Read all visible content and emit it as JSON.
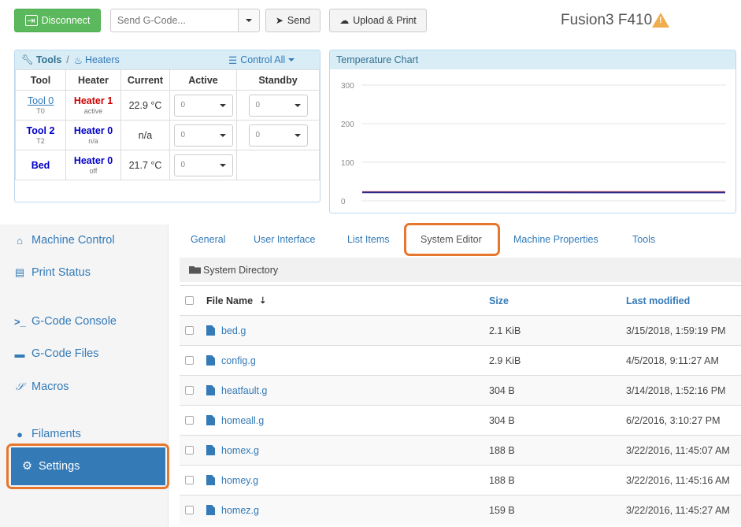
{
  "topbar": {
    "disconnect_label": "Disconnect",
    "gcode_placeholder": "Send G-Code...",
    "send_label": "Send",
    "upload_label": "Upload & Print",
    "machine_name": "Fusion3 F410",
    "warning_icon": "warning-icon",
    "warning_color": "#f0ad4e",
    "disconnect_color": "#5cb85c"
  },
  "tools_panel": {
    "breadcrumb_tools": "Tools",
    "breadcrumb_sep": "/",
    "breadcrumb_heaters": "Heaters",
    "control_all": "Control All",
    "columns": [
      "Tool",
      "Heater",
      "Current",
      "Active",
      "Standby"
    ],
    "rows": [
      {
        "tool": "Tool 0",
        "tool_sub": "T0",
        "heater": "Heater 1",
        "heater_sub": "active",
        "heater_color": "red",
        "current": "22.9 °C",
        "active": "0",
        "standby": "0"
      },
      {
        "tool": "Tool 2",
        "tool_sub": "T2",
        "heater": "Heater 0",
        "heater_sub": "n/a",
        "heater_color": "blue",
        "current": "n/a",
        "active": "0",
        "standby": "0"
      },
      {
        "tool": "Bed",
        "tool_sub": "",
        "heater": "Heater 0",
        "heater_sub": "off",
        "heater_color": "blue",
        "current": "21.7 °C",
        "active": "0",
        "standby": ""
      }
    ]
  },
  "chart_data": {
    "type": "line",
    "title": "Temperature Chart",
    "y_ticks": [
      "300",
      "200",
      "100",
      "0"
    ],
    "ylim": [
      0,
      300
    ],
    "series": [
      {
        "color": "#c83232",
        "values": [
          23,
          23,
          22.9,
          22.9
        ]
      },
      {
        "color": "#2a2a8a",
        "values": [
          22,
          21.9,
          21.8,
          21.7
        ]
      }
    ],
    "grid": true
  },
  "sidebar": {
    "items": [
      {
        "label": "Machine Control",
        "icon": "home-icon"
      },
      {
        "label": "Print Status",
        "icon": "print-icon"
      },
      {
        "label": "G-Code Console",
        "icon": "terminal-icon"
      },
      {
        "label": "G-Code Files",
        "icon": "hdd-icon"
      },
      {
        "label": "Macros",
        "icon": "macro-icon"
      },
      {
        "label": "Filaments",
        "icon": "filament-icon"
      },
      {
        "label": "Settings",
        "icon": "gear-icon"
      }
    ],
    "active": "Settings",
    "highlight_color": "#e8772e"
  },
  "tabs": [
    "General",
    "User Interface",
    "List Items",
    "System Editor",
    "Machine Properties",
    "Tools"
  ],
  "active_tab": "System Editor",
  "files": {
    "directory": "System Directory",
    "headers": {
      "name": "File Name",
      "size": "Size",
      "modified": "Last modified"
    },
    "rows": [
      {
        "name": "bed.g",
        "size": "2.1 KiB",
        "modified": "3/15/2018, 1:59:19 PM"
      },
      {
        "name": "config.g",
        "size": "2.9 KiB",
        "modified": "4/5/2018, 9:11:27 AM"
      },
      {
        "name": "heatfault.g",
        "size": "304 B",
        "modified": "3/14/2018, 1:52:16 PM"
      },
      {
        "name": "homeall.g",
        "size": "304 B",
        "modified": "6/2/2016, 3:10:27 PM"
      },
      {
        "name": "homex.g",
        "size": "188 B",
        "modified": "3/22/2016, 11:45:07 AM"
      },
      {
        "name": "homey.g",
        "size": "188 B",
        "modified": "3/22/2016, 11:45:16 AM"
      },
      {
        "name": "homez.g",
        "size": "159 B",
        "modified": "3/22/2016, 11:45:27 AM"
      }
    ]
  }
}
